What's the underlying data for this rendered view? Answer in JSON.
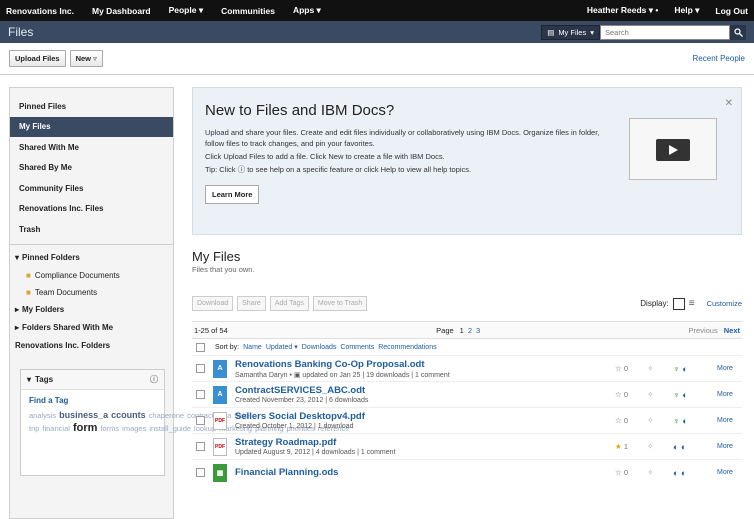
{
  "topbar": {
    "nav": [
      "Renovations Inc.",
      "My Dashboard",
      "People ▾",
      "Communities",
      "Apps ▾"
    ],
    "user": "Heather Reeds ▾ •",
    "help": "Help ▾",
    "logout": "Log Out"
  },
  "appbar": {
    "title": "Files",
    "scope": "My Files",
    "search_placeholder": "Search"
  },
  "toolbar": {
    "upload": "Upload Files",
    "new": "New",
    "recent_people": "Recent People"
  },
  "sidebar": {
    "items": [
      "Pinned Files",
      "My Files",
      "Shared With Me",
      "Shared By Me",
      "Community Files",
      "Renovations Inc. Files",
      "Trash"
    ],
    "pinned_folders_label": "Pinned Folders",
    "folders": [
      "Compliance Documents",
      "Team Documents"
    ],
    "tree": [
      "My Folders",
      "Folders Shared With Me",
      "Renovations Inc. Folders"
    ],
    "tags_label": "Tags",
    "find_tag": "Find a Tag",
    "tags": [
      "analysis",
      "business_a",
      "ccounts",
      "chaperone",
      "contract",
      "data",
      "field-trip",
      "financial",
      "form",
      "forms",
      "images",
      "install_guide",
      "lookup",
      "marketing",
      "planning",
      "priorities",
      "reference"
    ]
  },
  "welcome": {
    "title": "New to Files and IBM Docs?",
    "line1": "Upload and share your files. Create and edit files individually or collaboratively using IBM Docs. Organize files in folder, follow files to track changes, and pin your favorites.",
    "line2": "Click Upload Files to add a file. Click New to create a file with IBM Docs.",
    "line3": "Tip: Click ⓘ to see help on a specific feature or click Help to view all help topics.",
    "learn_more": "Learn More"
  },
  "files": {
    "title": "My Files",
    "subtitle": "Files that you own.",
    "actions": [
      "Download",
      "Share",
      "Add Tags",
      "Move to Trash"
    ],
    "display_label": "Display:",
    "customize": "Customize",
    "range": "1-25 of 54",
    "page_label": "Page",
    "pages": [
      "1",
      "2",
      "3"
    ],
    "previous": "Previous",
    "next": "Next",
    "sort_label": "Sort by:",
    "sort_options": [
      "Name",
      "Updated ▾",
      "Downloads",
      "Comments",
      "Recommendations"
    ],
    "rows": [
      {
        "name": "Renovations Banking Co-Op Proposal.odt",
        "meta": "Samantha Daryn • ▣ updated on Jan 25 | 19 downloads | 1 comment",
        "type": "A",
        "rating": "0",
        "more": "More"
      },
      {
        "name": "ContractSERVICES_ABC.odt",
        "meta": "Created November 23, 2012 | 6 downloads",
        "type": "A",
        "rating": "0",
        "more": "More"
      },
      {
        "name": "Sellers Social Desktopv4.pdf",
        "meta": "Created October 1, 2012 | 1 download",
        "type": "PDF",
        "rating": "0",
        "more": "More"
      },
      {
        "name": "Strategy Roadmap.pdf",
        "meta": "Updated August 9, 2012 | 4 downloads | 1 comment",
        "type": "PDF",
        "rating": "1",
        "more": "More"
      },
      {
        "name": "Financial Planning.ods",
        "meta": "",
        "type": "▦",
        "rating": "0",
        "more": "More"
      }
    ]
  }
}
